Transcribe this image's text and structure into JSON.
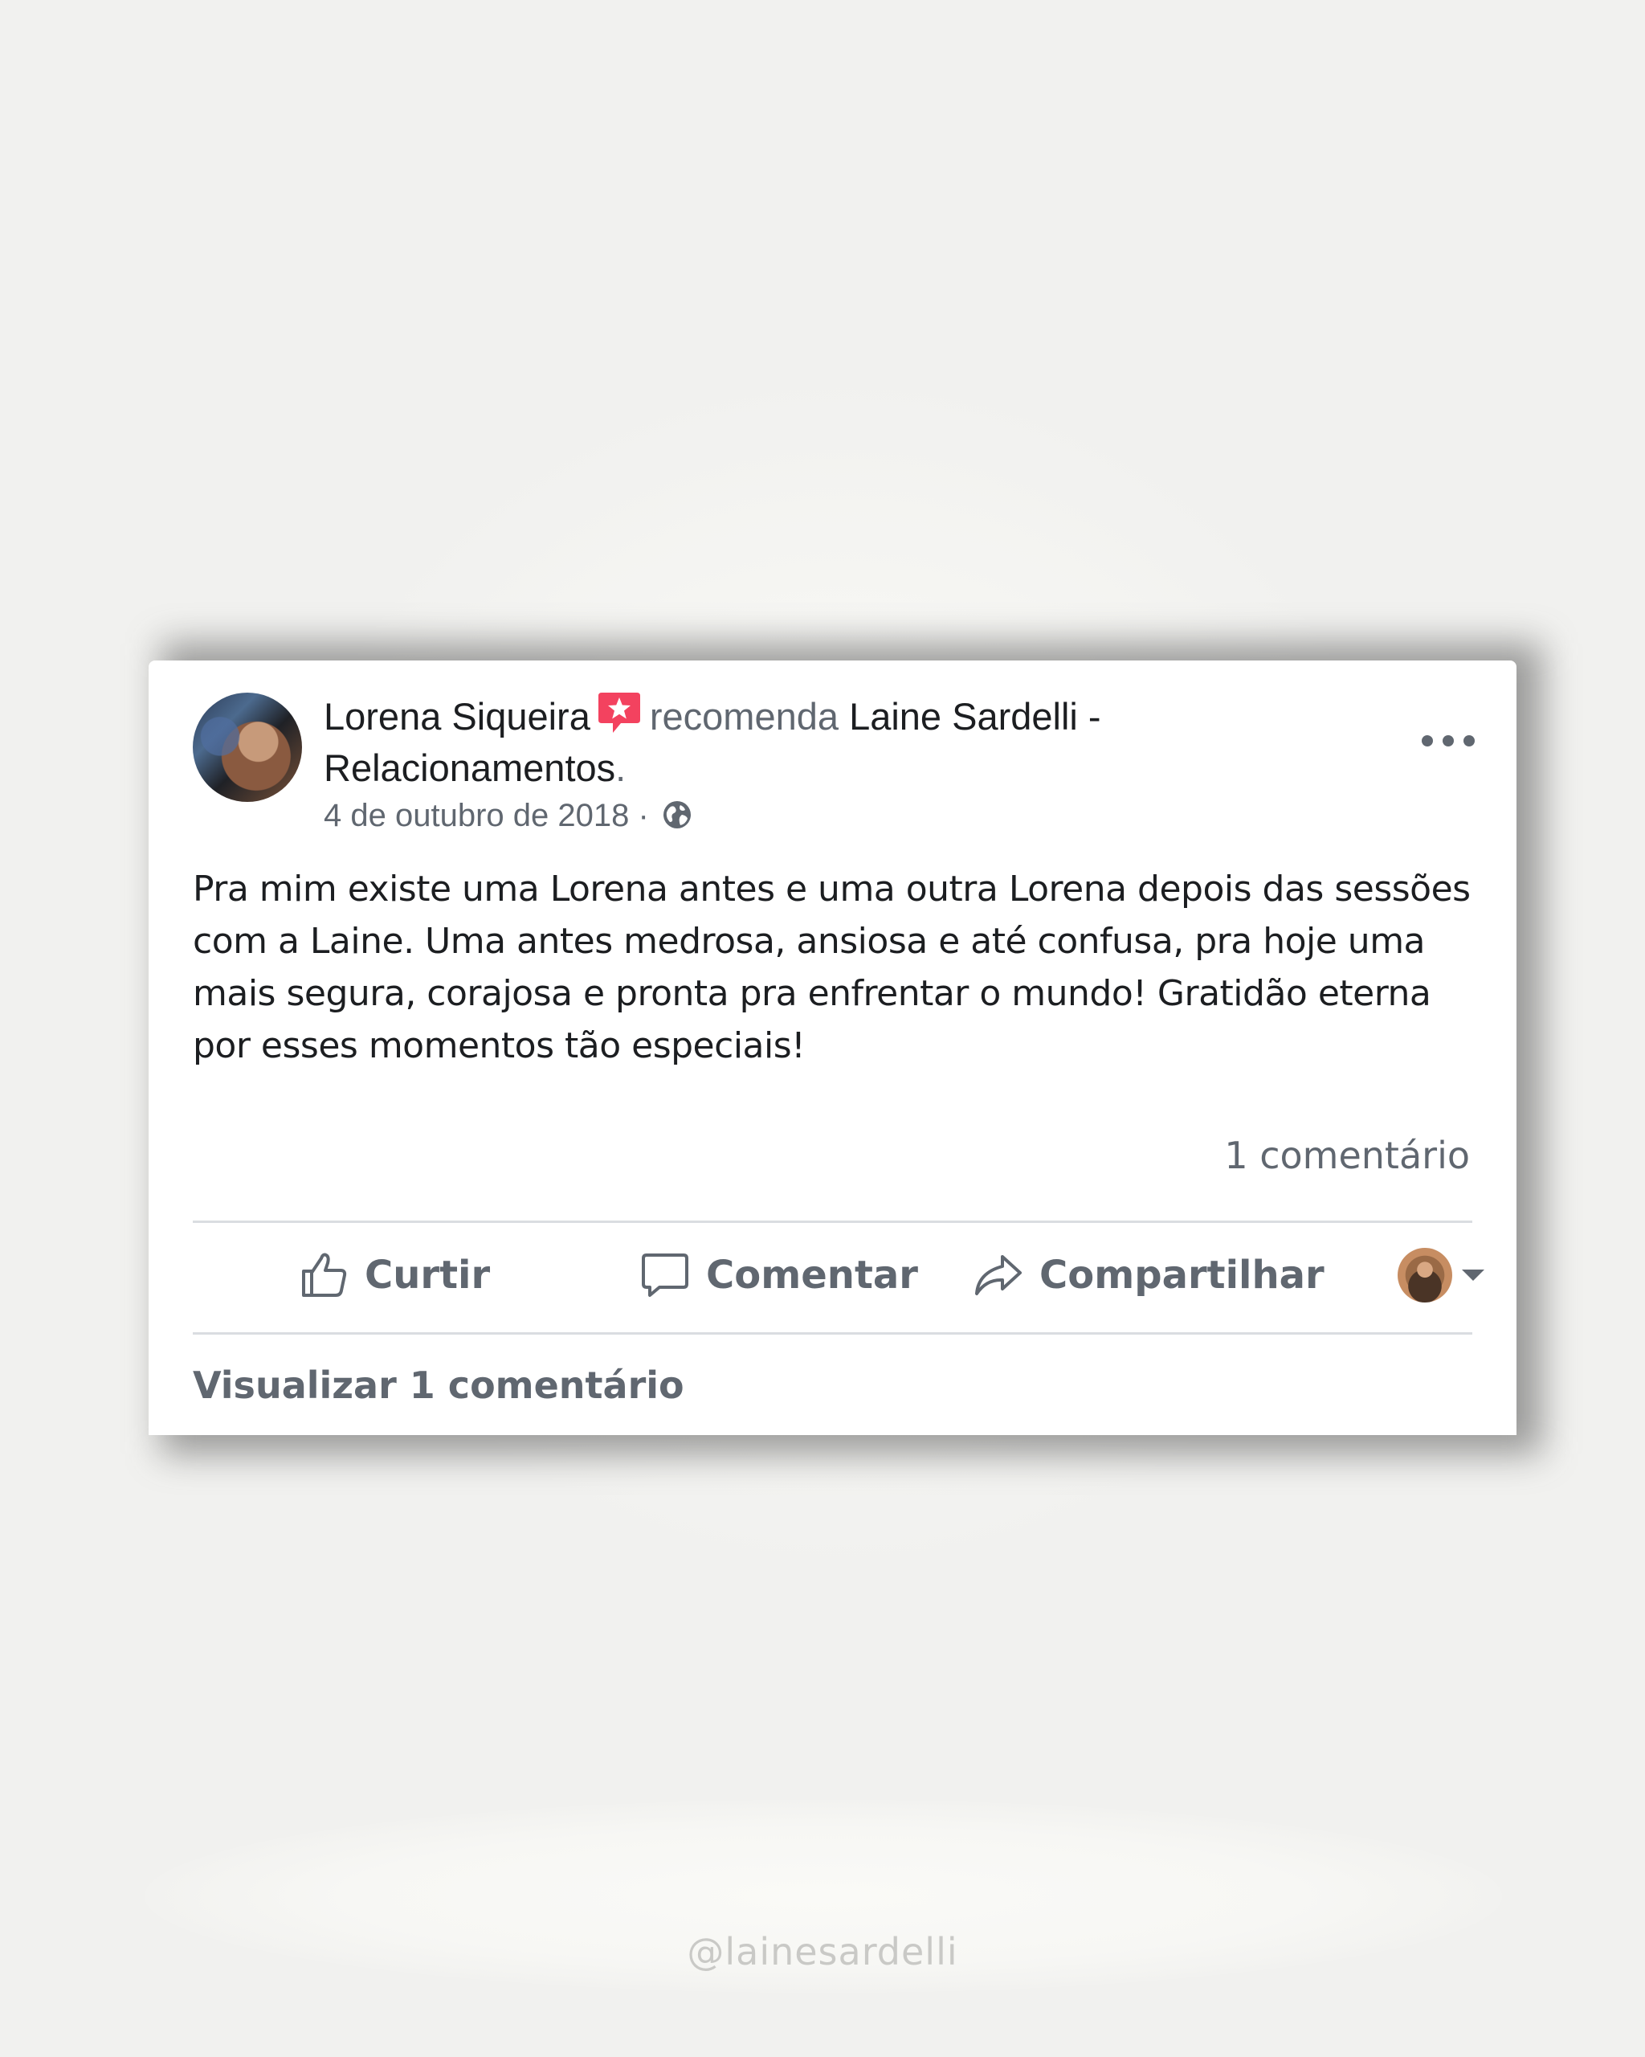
{
  "post": {
    "author": "Lorena Siqueira",
    "verb": "recomenda",
    "page_line1": "Laine Sardelli -",
    "page_line2": "Relacionamentos",
    "page_suffix": ".",
    "date": "4 de outubro de 2018",
    "date_separator": " · ",
    "body": "Pra mim existe uma Lorena antes e uma outra Lorena depois das sessões com a Laine. Uma antes medrosa, ansiosa e até confusa, pra hoje uma mais segura, corajosa e pronta pra enfrentar o mundo! Gratidão eterna por esses momentos tão especiais!",
    "comment_count": "1 comentário",
    "view_comments": "Visualizar 1 comentário"
  },
  "actions": {
    "like": "Curtir",
    "comment": "Comentar",
    "share": "Compartilhar"
  },
  "icons": {
    "recommendation": "recommend-star-icon",
    "audience": "globe-icon",
    "more": "more-options-icon",
    "like": "thumbs-up-icon",
    "comment": "speech-bubble-icon",
    "share": "share-arrow-icon",
    "dropdown": "caret-down-icon"
  },
  "footer": {
    "handle": "@lainesardelli"
  },
  "colors": {
    "background": "#f1f1ef",
    "card": "#ffffff",
    "text_primary": "#1c1e21",
    "text_secondary": "#606770",
    "badge": "#f3425f",
    "divider": "#dadde1",
    "handle": "#c9c9c6"
  }
}
